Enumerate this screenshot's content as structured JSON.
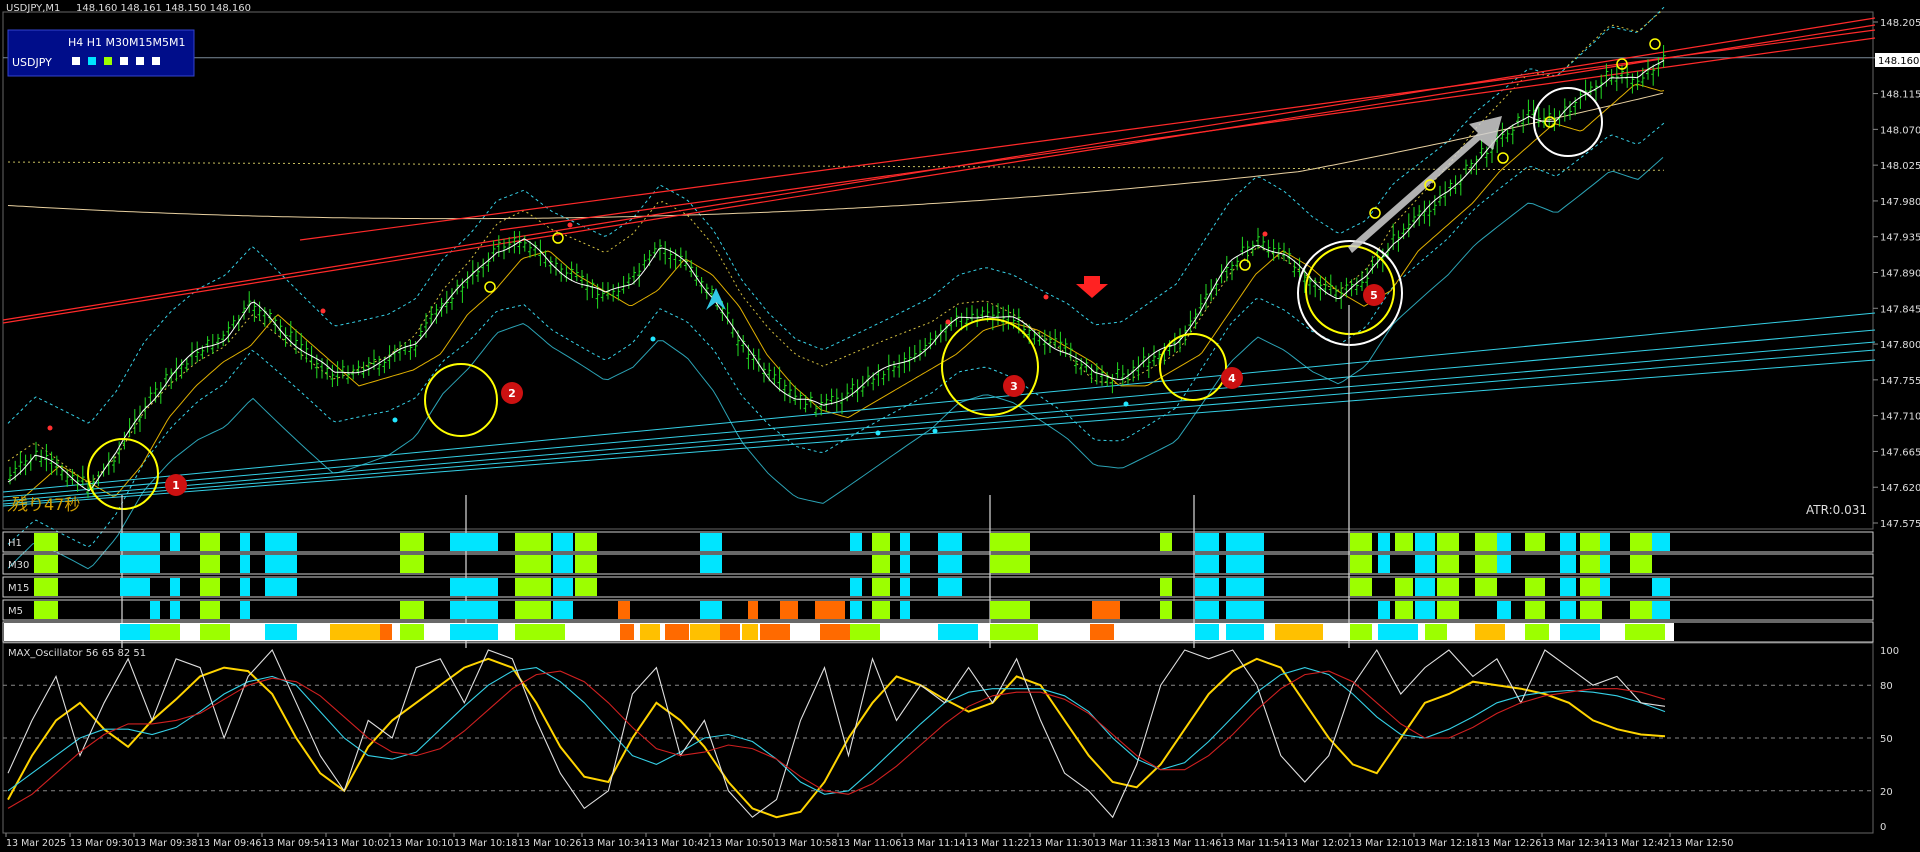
{
  "window": {
    "title": "USDJPY,M1",
    "ohlc": "148.160 148.161 148.150 148.160",
    "symbol": "USDJPY",
    "timeframes": "H4 H1 M30M15M5M1",
    "countdown": "残り47秒",
    "atr": "ATR:0.031",
    "current_price": "148.160",
    "oscillator_title": "MAX_Oscillator 56 65 82 51"
  },
  "mtf_rows": [
    "H1",
    "M30",
    "M15",
    "M5"
  ],
  "markers": [
    "1",
    "2",
    "3",
    "4",
    "5"
  ],
  "colors": {
    "background": "#000000",
    "bull": "#22dd22",
    "resistance": "#ff2a2a",
    "support": "#35d0e6",
    "cyan_block": "#00e5ff",
    "lime_block": "#9cff00",
    "orange_block": "#ff6a00",
    "yellow_circle": "#ffff00",
    "label_red": "#cc1111"
  },
  "chart_data": [
    {
      "type": "line",
      "title": "USDJPY,M1",
      "y_ticks": [
        "148.205",
        "148.160",
        "148.115",
        "148.070",
        "148.025",
        "147.980",
        "147.935",
        "147.890",
        "147.845",
        "147.800",
        "147.755",
        "147.710",
        "147.665",
        "147.620",
        "147.575"
      ],
      "ylim": [
        147.575,
        148.205
      ],
      "x_ticks": [
        "13 Mar 2025",
        "13 Mar 09:30",
        "13 Mar 09:38",
        "13 Mar 09:46",
        "13 Mar 09:54",
        "13 Mar 10:02",
        "13 Mar 10:10",
        "13 Mar 10:18",
        "13 Mar 10:26",
        "13 Mar 10:34",
        "13 Mar 10:42",
        "13 Mar 10:50",
        "13 Mar 10:58",
        "13 Mar 11:06",
        "13 Mar 11:14",
        "13 Mar 11:22",
        "13 Mar 11:30",
        "13 Mar 11:38",
        "13 Mar 11:46",
        "13 Mar 11:54",
        "13 Mar 12:02",
        "13 Mar 12:10",
        "13 Mar 12:18",
        "13 Mar 12:26",
        "13 Mar 12:34",
        "13 Mar 12:42",
        "13 Mar 12:50"
      ],
      "series": [
        {
          "values": [
            147.63,
            147.66,
            147.64,
            147.62,
            147.66,
            147.72,
            147.76,
            147.79,
            147.81,
            147.85,
            147.82,
            147.79,
            147.76,
            147.77,
            147.78,
            147.8,
            147.85,
            147.88,
            147.92,
            147.93,
            147.9,
            147.88,
            147.86,
            147.88,
            147.92,
            147.9,
            147.86,
            147.8,
            147.76,
            147.73,
            147.72,
            147.74,
            147.76,
            147.78,
            147.8,
            147.83,
            147.84,
            147.83,
            147.81,
            147.79,
            147.76,
            147.76,
            147.78,
            147.8,
            147.85,
            147.9,
            147.93,
            147.91,
            147.88,
            147.86,
            147.88,
            147.93,
            147.96,
            147.99,
            148.03,
            148.06,
            148.09,
            148.08,
            148.11,
            148.14,
            148.13,
            148.16
          ]
        }
      ]
    },
    {
      "type": "line",
      "title": "MAX_Oscillator 56 65 82 51",
      "y_ticks": [
        "100",
        "80",
        "50",
        "20",
        "0"
      ],
      "ylim": [
        0,
        100
      ],
      "series": [
        {
          "values": [
            15,
            40,
            60,
            70,
            55,
            45,
            60,
            72,
            85,
            90,
            88,
            75,
            50,
            30,
            20,
            45,
            60,
            70,
            80,
            90,
            95,
            90,
            70,
            45,
            28,
            25,
            50,
            70,
            60,
            45,
            25,
            10,
            5,
            8,
            25,
            50,
            70,
            85,
            80,
            72,
            65,
            70,
            85,
            80,
            60,
            40,
            25,
            22,
            35,
            55,
            75,
            88,
            95,
            90,
            70,
            50,
            35,
            30,
            50,
            70,
            75,
            82,
            80,
            78,
            75,
            70,
            60,
            55,
            52,
            51
          ]
        },
        {
          "values": [
            20,
            30,
            40,
            50,
            55,
            55,
            52,
            56,
            65,
            75,
            82,
            85,
            80,
            65,
            50,
            40,
            38,
            42,
            55,
            68,
            80,
            88,
            90,
            82,
            70,
            55,
            40,
            35,
            42,
            50,
            52,
            48,
            38,
            25,
            18,
            20,
            32,
            45,
            58,
            70,
            76,
            78,
            78,
            78,
            74,
            65,
            50,
            38,
            32,
            36,
            48,
            62,
            76,
            86,
            90,
            86,
            75,
            62,
            52,
            50,
            55,
            62,
            70,
            74,
            76,
            77,
            76,
            74,
            70,
            65
          ]
        },
        {
          "values": [
            30,
            60,
            85,
            40,
            70,
            95,
            60,
            95,
            90,
            50,
            85,
            100,
            70,
            40,
            20,
            60,
            50,
            90,
            95,
            70,
            100,
            95,
            60,
            30,
            10,
            20,
            75,
            90,
            40,
            60,
            20,
            5,
            15,
            60,
            90,
            40,
            95,
            60,
            80,
            70,
            90,
            70,
            95,
            60,
            30,
            20,
            5,
            35,
            80,
            100,
            95,
            100,
            80,
            40,
            25,
            40,
            80,
            100,
            75,
            90,
            100,
            85,
            95,
            70,
            100,
            90,
            80,
            85,
            70,
            68
          ]
        },
        {
          "values": [
            10,
            18,
            30,
            42,
            52,
            58,
            58,
            60,
            64,
            72,
            80,
            84,
            82,
            74,
            62,
            50,
            42,
            40,
            44,
            54,
            66,
            78,
            86,
            88,
            82,
            70,
            56,
            44,
            40,
            42,
            46,
            44,
            38,
            28,
            20,
            18,
            24,
            34,
            46,
            58,
            68,
            74,
            76,
            76,
            72,
            64,
            52,
            40,
            32,
            32,
            40,
            52,
            66,
            78,
            86,
            88,
            82,
            70,
            58,
            50,
            50,
            56,
            64,
            70,
            74,
            76,
            78,
            78,
            76,
            72
          ]
        }
      ]
    }
  ]
}
